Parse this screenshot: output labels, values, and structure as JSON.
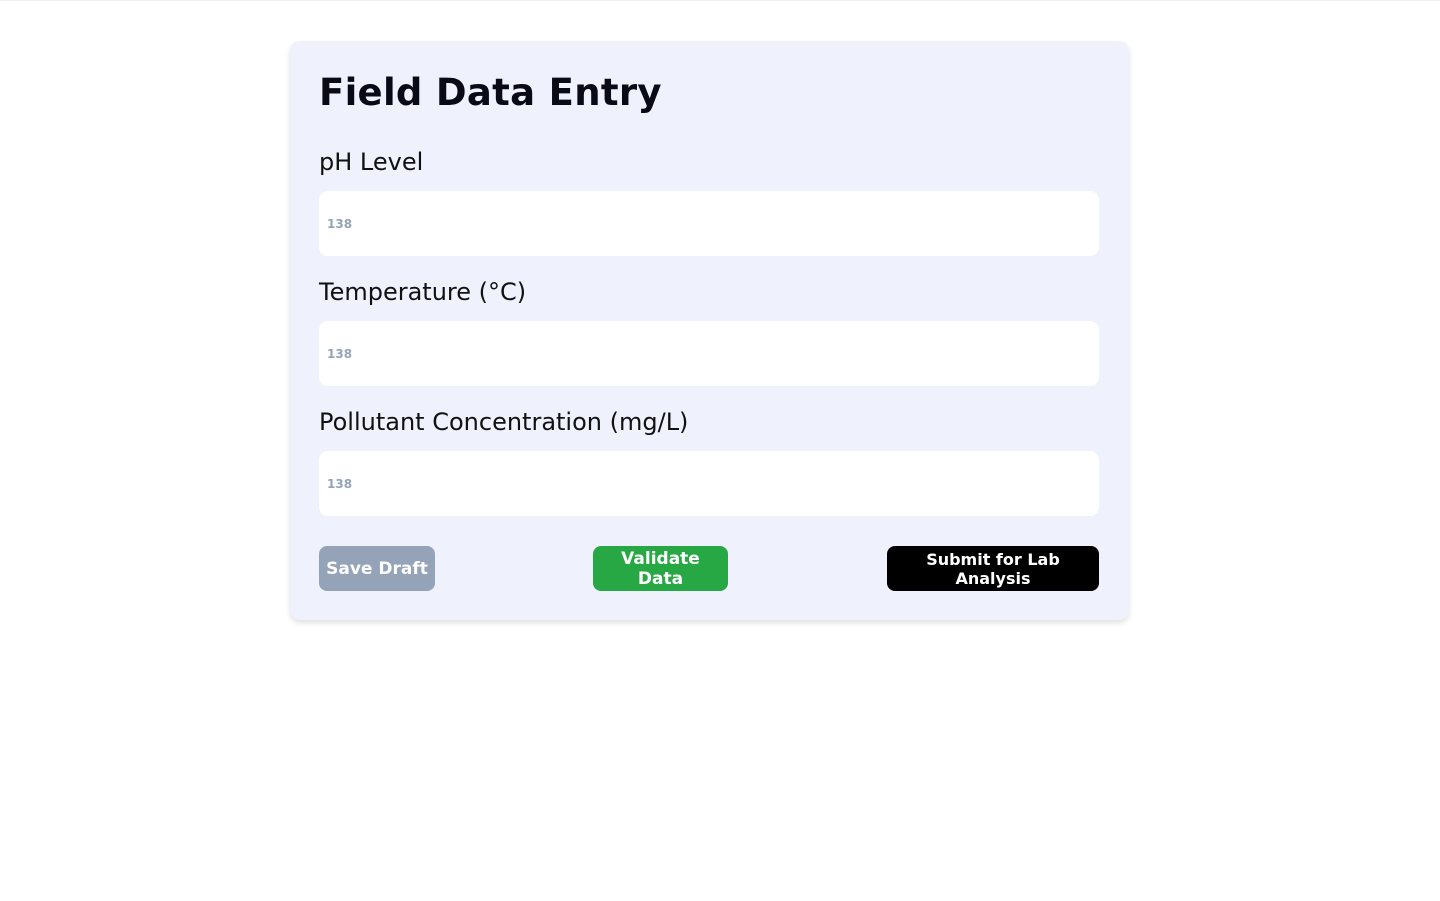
{
  "form": {
    "title": "Field Data Entry",
    "fields": [
      {
        "label": "pH Level",
        "placeholder": "138"
      },
      {
        "label": "Temperature (°C)",
        "placeholder": "138"
      },
      {
        "label": "Pollutant Concentration (mg/L)",
        "placeholder": "138"
      }
    ],
    "buttons": {
      "save": "Save Draft",
      "validate": "Validate Data",
      "submit": "Submit for Lab Analysis"
    }
  },
  "colors": {
    "save": "#94a3b8",
    "validate": "#28a745",
    "submit": "#000000",
    "card": "#eff1fd"
  }
}
